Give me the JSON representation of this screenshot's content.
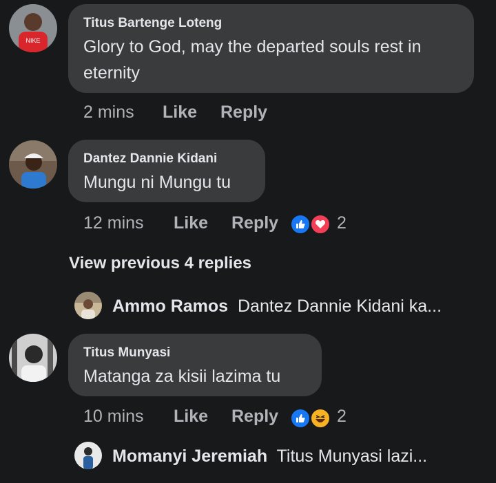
{
  "comments": [
    {
      "author": "Titus Bartenge Loteng",
      "text": "Glory to God, may the departed souls rest in eternity",
      "time": "2 mins",
      "like_label": "Like",
      "reply_label": "Reply"
    },
    {
      "author": "Dantez Dannie Kidani",
      "text": "Mungu ni Mungu tu",
      "time": "12 mins",
      "like_label": "Like",
      "reply_label": "Reply",
      "reactions": [
        "like-icon",
        "love-icon"
      ],
      "reaction_count": "2"
    },
    {
      "author": "Titus Munyasi",
      "text": "Matanga za kisii lazima tu",
      "time": "10 mins",
      "like_label": "Like",
      "reply_label": "Reply",
      "reactions": [
        "like-icon",
        "haha-icon"
      ],
      "reaction_count": "2"
    }
  ],
  "view_previous": "View previous 4 replies",
  "replies": [
    {
      "author": "Ammo Ramos",
      "preview": "Dantez Dannie Kidani ka..."
    },
    {
      "author": "Momanyi Jeremiah",
      "preview": "Titus Munyasi lazi..."
    }
  ],
  "colors": {
    "background": "#18191a",
    "bubble": "#3a3b3c",
    "text": "#e4e6eb",
    "muted": "#b0b3b8",
    "like_blue": "#1877f2",
    "love_red": "#f33e58",
    "haha_yellow": "#f7b125"
  }
}
